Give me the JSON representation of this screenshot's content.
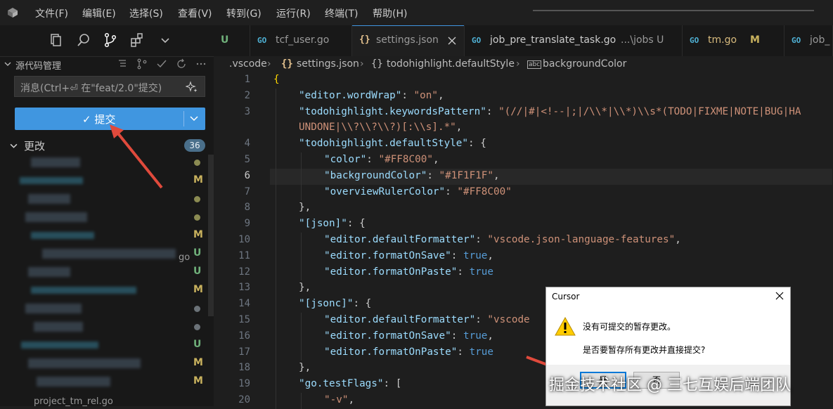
{
  "menu": [
    "文件(F)",
    "编辑(E)",
    "选择(S)",
    "查看(V)",
    "转到(G)",
    "运行(R)",
    "终端(T)",
    "帮助(H)"
  ],
  "scm": {
    "title": "源代码管理",
    "message_placeholder": "消息(Ctrl+⏎ 在\"feat/2.0\"提交)",
    "commit_label": "✓ 提交",
    "changes_label": "更改",
    "changes_count": "36",
    "partial_go_suffix": "go",
    "partial_file": "project_tm_rel.go",
    "file_statuses": [
      {
        "type": "dot",
        "color": "#8b8b52"
      },
      {
        "type": "letter",
        "text": "M",
        "color": "#c9b25e"
      },
      {
        "type": "dot",
        "color": "#8b8b52"
      },
      {
        "type": "dot",
        "color": "#8b8b52"
      },
      {
        "type": "letter",
        "text": "M",
        "color": "#c9b25e"
      },
      {
        "type": "letter",
        "text": "U",
        "color": "#6fb07a"
      },
      {
        "type": "letter",
        "text": "U",
        "color": "#6fb07a"
      },
      {
        "type": "letter",
        "text": "M",
        "color": "#c9b25e"
      },
      {
        "type": "dot",
        "color": "#6b7278"
      },
      {
        "type": "dot",
        "color": "#6b7278"
      },
      {
        "type": "letter",
        "text": "U",
        "color": "#6fb07a"
      },
      {
        "type": "letter",
        "text": "M",
        "color": "#c9b25e"
      },
      {
        "type": "letter",
        "text": "M",
        "color": "#c9b25e"
      }
    ]
  },
  "tabs": [
    {
      "label": "U",
      "icon": "",
      "mod": "",
      "active": false
    },
    {
      "label": "tcf_user.go",
      "icon": "GO",
      "mod": "",
      "active": false
    },
    {
      "label": "settings.json",
      "icon": "{}",
      "mod": "",
      "active": true
    },
    {
      "label": "job_pre_translate_task.go",
      "icon": "GO",
      "mod": "...\\jobs U",
      "active": false
    },
    {
      "label": "tm.go",
      "icon": "GO",
      "mod": "M",
      "active": false
    },
    {
      "label": "job_",
      "icon": "GO",
      "mod": "",
      "active": false
    }
  ],
  "breadcrumb": [
    ".vscode",
    "settings.json",
    "todohighlight.defaultStyle",
    "backgroundColor"
  ],
  "code_lines": [
    {
      "n": "1",
      "indent": 0,
      "parts": [
        [
          "b",
          "{"
        ]
      ]
    },
    {
      "n": "2",
      "indent": 1,
      "parts": [
        [
          "k",
          "\"editor.wordWrap\""
        ],
        [
          "p",
          ": "
        ],
        [
          "s",
          "\"on\""
        ],
        [
          "p",
          ","
        ]
      ]
    },
    {
      "n": "3",
      "indent": 1,
      "parts": [
        [
          "k",
          "\"todohighlight.keywordsPattern\""
        ],
        [
          "p",
          ": "
        ],
        [
          "s",
          "\"(//|#|<!--|;|/\\\\*|\\\\*)\\\\s*(TODO|FIXME|NOTE|BUG|HA"
        ]
      ]
    },
    {
      "n": "",
      "indent": 1,
      "parts": [
        [
          "s",
          "UNDONE|\\\\?\\\\?\\\\?)[:\\\\s].*\""
        ],
        [
          "p",
          ","
        ]
      ]
    },
    {
      "n": "4",
      "indent": 1,
      "parts": [
        [
          "k",
          "\"todohighlight.defaultStyle\""
        ],
        [
          "p",
          ": {"
        ]
      ]
    },
    {
      "n": "5",
      "indent": 2,
      "parts": [
        [
          "k",
          "\"color\""
        ],
        [
          "p",
          ": "
        ],
        [
          "s",
          "\"#FF8C00\""
        ],
        [
          "p",
          ","
        ]
      ]
    },
    {
      "n": "6",
      "indent": 2,
      "parts": [
        [
          "k",
          "\"backgroundColor\""
        ],
        [
          "p",
          ": "
        ],
        [
          "s",
          "\"#1F1F1F\""
        ],
        [
          "p",
          ","
        ]
      ]
    },
    {
      "n": "7",
      "indent": 2,
      "parts": [
        [
          "k",
          "\"overviewRulerColor\""
        ],
        [
          "p",
          ": "
        ],
        [
          "s",
          "\"#FF8C00\""
        ]
      ]
    },
    {
      "n": "8",
      "indent": 1,
      "parts": [
        [
          "p",
          "},"
        ]
      ]
    },
    {
      "n": "9",
      "indent": 1,
      "parts": [
        [
          "k",
          "\"[json]\""
        ],
        [
          "p",
          ": {"
        ]
      ]
    },
    {
      "n": "10",
      "indent": 2,
      "parts": [
        [
          "k",
          "\"editor.defaultFormatter\""
        ],
        [
          "p",
          ": "
        ],
        [
          "s",
          "\"vscode.json-language-features\""
        ],
        [
          "p",
          ","
        ]
      ]
    },
    {
      "n": "11",
      "indent": 2,
      "parts": [
        [
          "k",
          "\"editor.formatOnSave\""
        ],
        [
          "p",
          ": "
        ],
        [
          "v",
          "true"
        ],
        [
          "p",
          ","
        ]
      ]
    },
    {
      "n": "12",
      "indent": 2,
      "parts": [
        [
          "k",
          "\"editor.formatOnPaste\""
        ],
        [
          "p",
          ": "
        ],
        [
          "v",
          "true"
        ]
      ]
    },
    {
      "n": "13",
      "indent": 1,
      "parts": [
        [
          "p",
          "},"
        ]
      ]
    },
    {
      "n": "14",
      "indent": 1,
      "parts": [
        [
          "k",
          "\"[jsonc]\""
        ],
        [
          "p",
          ": {"
        ]
      ]
    },
    {
      "n": "15",
      "indent": 2,
      "parts": [
        [
          "k",
          "\"editor.defaultFormatter\""
        ],
        [
          "p",
          ": "
        ],
        [
          "s",
          "\"vscode"
        ]
      ]
    },
    {
      "n": "16",
      "indent": 2,
      "parts": [
        [
          "k",
          "\"editor.formatOnSave\""
        ],
        [
          "p",
          ": "
        ],
        [
          "v",
          "true"
        ],
        [
          "p",
          ","
        ]
      ]
    },
    {
      "n": "17",
      "indent": 2,
      "parts": [
        [
          "k",
          "\"editor.formatOnPaste\""
        ],
        [
          "p",
          ": "
        ],
        [
          "v",
          "true"
        ]
      ]
    },
    {
      "n": "18",
      "indent": 1,
      "parts": [
        [
          "p",
          "},"
        ]
      ]
    },
    {
      "n": "19",
      "indent": 1,
      "parts": [
        [
          "k",
          "\"go.testFlags\""
        ],
        [
          "p",
          ": ["
        ]
      ]
    },
    {
      "n": "20",
      "indent": 2,
      "parts": [
        [
          "s",
          "\"-v\""
        ],
        [
          "p",
          ","
        ]
      ]
    }
  ],
  "dialog": {
    "title": "Cursor",
    "message1": "没有可提交的暂存更改。",
    "message2": "是否要暂存所有更改并直接提交?",
    "yes": "是",
    "no": "否"
  },
  "watermark": "掘金技术社区 @ 三七互娱后端团队",
  "colors": {
    "accent": "#4096e0",
    "annotation_arrow": "#e04a3c"
  }
}
